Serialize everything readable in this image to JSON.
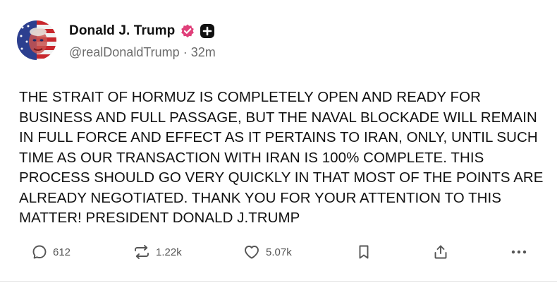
{
  "post": {
    "author": {
      "display_name": "Donald J. Trump",
      "handle": "@realDonaldTrump",
      "separator": "·",
      "time_ago": "32m",
      "verified_badge_icon": "verified-check-icon",
      "plus_badge_icon": "plus-icon",
      "verified_color": "#e0407a"
    },
    "text": "THE STRAIT OF HORMUZ IS COMPLETELY OPEN AND READY FOR BUSINESS AND FULL PASSAGE, BUT THE NAVAL BLOCKADE WILL REMAIN IN FULL FORCE AND EFFECT AS IT PERTAINS TO IRAN, ONLY, UNTIL SUCH TIME AS OUR TRANSACTION WITH IRAN IS 100% COMPLETE. THIS PROCESS SHOULD GO VERY QUICKLY IN THAT MOST OF THE POINTS ARE ALREADY NEGOTIATED. THANK YOU FOR YOUR ATTENTION TO THIS MATTER! PRESIDENT DONALD J.TRUMP"
  },
  "actions": {
    "reply": {
      "icon": "reply-icon",
      "count": "612"
    },
    "repost": {
      "icon": "repost-icon",
      "count": "1.22k"
    },
    "like": {
      "icon": "heart-icon",
      "count": "5.07k"
    },
    "bookmark": {
      "icon": "bookmark-icon"
    },
    "share": {
      "icon": "share-icon"
    },
    "more": {
      "icon": "more-icon"
    }
  }
}
